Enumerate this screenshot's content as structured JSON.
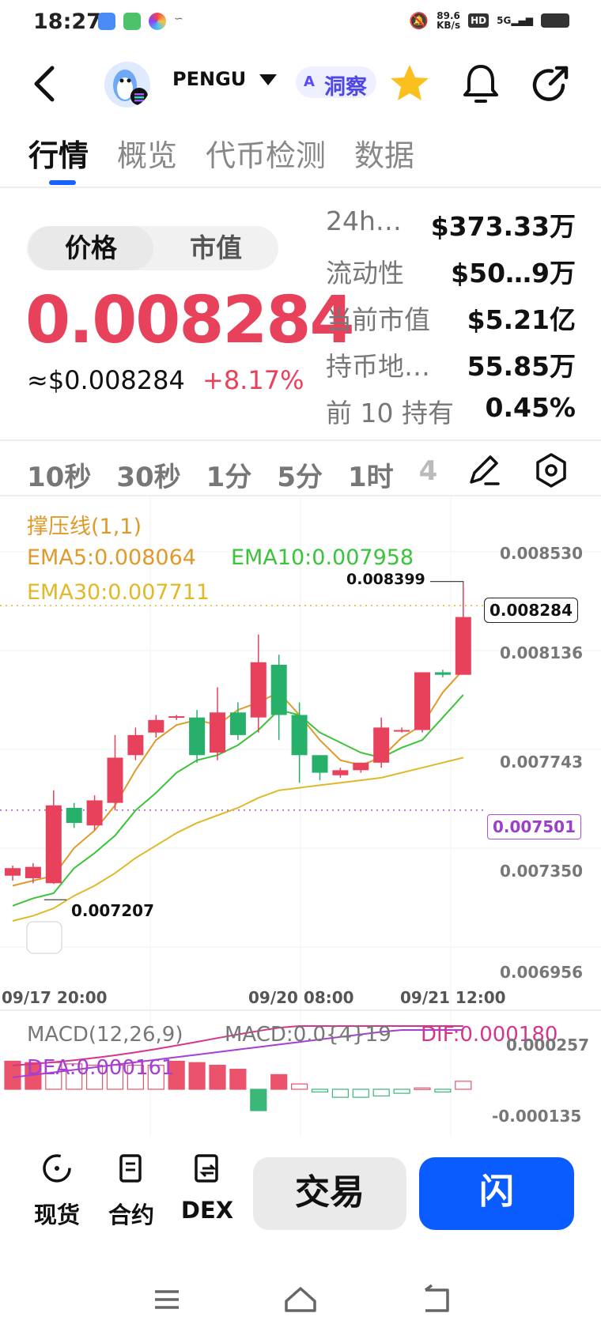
{
  "status_bar": {
    "time": "18:27",
    "net_speed": "89.6",
    "net_unit": "KB/s",
    "hd": "HD",
    "signal": "5G"
  },
  "header": {
    "token": "PENGU",
    "ai_prefix": "A",
    "ai_label": "洞察"
  },
  "tabs": [
    {
      "label": "行情",
      "active": true
    },
    {
      "label": "概览",
      "active": false
    },
    {
      "label": "代币检测",
      "active": false
    },
    {
      "label": "数据",
      "active": false
    }
  ],
  "price_toggle": {
    "price": "价格",
    "market_cap": "市值"
  },
  "price": {
    "main": "0.008284",
    "usd": "≈$0.008284",
    "change": "+8.17%"
  },
  "stats": [
    {
      "label": "24h…",
      "value": "$373.33万"
    },
    {
      "label": "流动性",
      "value": "$50…9万"
    },
    {
      "label": "当前市值",
      "value": "$5.21亿"
    },
    {
      "label": "持币地…",
      "value": "55.85万"
    },
    {
      "label": "前 10 持有",
      "value": "0.45%"
    }
  ],
  "timeframes": [
    "10秒",
    "30秒",
    "1分",
    "5分",
    "1时",
    "4"
  ],
  "legend": {
    "support": "撑压线(1,1)",
    "ema5": "EMA5:0.008064",
    "ema10": "EMA10:0.007958",
    "ema30": "EMA30:0.007711"
  },
  "axis": {
    "y_labels": [
      "0.008530",
      "0.008136",
      "0.007743",
      "0.007350",
      "0.006956"
    ],
    "current_tag": "0.008284",
    "support_tag": "0.007501",
    "high_label": "0.008399",
    "low_label": "0.007207",
    "x_labels": [
      "09/17 20:00",
      "09/20 08:00",
      "09/21 12:00"
    ]
  },
  "macd": {
    "title": "MACD(12,26,9)",
    "macd": "MACD:0.0{4}19",
    "dif": "DIF:0.000180",
    "dea": "DEA:0.000161",
    "y_top": "0.000257",
    "y_bottom": "-0.000135"
  },
  "colors": {
    "up": "#e8415b",
    "down": "#26b06a",
    "accent": "#1663ff",
    "ema5": "#e09a2a",
    "ema10": "#3ac43a",
    "ema30": "#e0b82a"
  },
  "chart_data": {
    "type": "candlestick",
    "ylim": [
      0.006956,
      0.00853
    ],
    "candles": [
      {
        "o": 0.00724,
        "c": 0.00727,
        "h": 0.00728,
        "l": 0.00722
      },
      {
        "o": 0.00723,
        "c": 0.007275,
        "h": 0.00729,
        "l": 0.00721
      },
      {
        "o": 0.00721,
        "c": 0.00752,
        "h": 0.00758,
        "l": 0.007207
      },
      {
        "o": 0.00751,
        "c": 0.00745,
        "h": 0.00753,
        "l": 0.00743
      },
      {
        "o": 0.00744,
        "c": 0.00754,
        "h": 0.00756,
        "l": 0.00742
      },
      {
        "o": 0.00753,
        "c": 0.00771,
        "h": 0.0078,
        "l": 0.0075
      },
      {
        "o": 0.00772,
        "c": 0.0078,
        "h": 0.00783,
        "l": 0.0077
      },
      {
        "o": 0.00781,
        "c": 0.00786,
        "h": 0.00788,
        "l": 0.00779
      },
      {
        "o": 0.00787,
        "c": 0.007875,
        "h": 0.00788,
        "l": 0.00786
      },
      {
        "o": 0.00787,
        "c": 0.00772,
        "h": 0.0079,
        "l": 0.00769
      },
      {
        "o": 0.00773,
        "c": 0.00789,
        "h": 0.00799,
        "l": 0.0077
      },
      {
        "o": 0.00789,
        "c": 0.0078,
        "h": 0.00793,
        "l": 0.00778
      },
      {
        "o": 0.00787,
        "c": 0.00809,
        "h": 0.0082,
        "l": 0.00781
      },
      {
        "o": 0.00808,
        "c": 0.00788,
        "h": 0.00812,
        "l": 0.00778
      },
      {
        "o": 0.00788,
        "c": 0.00772,
        "h": 0.00793,
        "l": 0.00761
      },
      {
        "o": 0.00772,
        "c": 0.00765,
        "h": 0.00772,
        "l": 0.00762
      },
      {
        "o": 0.00764,
        "c": 0.00766,
        "h": 0.00767,
        "l": 0.00763
      },
      {
        "o": 0.00766,
        "c": 0.00769,
        "h": 0.00769,
        "l": 0.00765
      },
      {
        "o": 0.00769,
        "c": 0.00783,
        "h": 0.00787,
        "l": 0.00767
      },
      {
        "o": 0.00782,
        "c": 0.00782,
        "h": 0.00783,
        "l": 0.00781
      },
      {
        "o": 0.00782,
        "c": 0.00805,
        "h": 0.00805,
        "l": 0.00781
      },
      {
        "o": 0.00805,
        "c": 0.00804,
        "h": 0.00806,
        "l": 0.00803
      },
      {
        "o": 0.00804,
        "c": 0.00827,
        "h": 0.008399,
        "l": 0.00804
      }
    ],
    "ema5": [
      0.0072,
      0.00722,
      0.00724,
      0.00735,
      0.00742,
      0.00752,
      0.00766,
      0.00778,
      0.00784,
      0.00786,
      0.00784,
      0.0079,
      0.00793,
      0.00797,
      0.00788,
      0.00778,
      0.0077,
      0.00768,
      0.00771,
      0.00779,
      0.00784,
      0.00797,
      0.00806
    ],
    "ema10": [
      0.00712,
      0.00715,
      0.00717,
      0.00727,
      0.00733,
      0.0074,
      0.0075,
      0.00757,
      0.00765,
      0.0077,
      0.00772,
      0.00776,
      0.00782,
      0.0079,
      0.00788,
      0.00781,
      0.00777,
      0.00773,
      0.00771,
      0.00775,
      0.00778,
      0.00787,
      0.00796
    ],
    "ema30": [
      0.00706,
      0.00708,
      0.00711,
      0.00716,
      0.0072,
      0.00725,
      0.00731,
      0.00736,
      0.00741,
      0.00745,
      0.00748,
      0.00751,
      0.00755,
      0.00758,
      0.00759,
      0.0076,
      0.00761,
      0.00762,
      0.00763,
      0.00765,
      0.00767,
      0.00769,
      0.00771
    ],
    "support_level": 0.007501,
    "current_level": 0.008284,
    "macd_hist": [
      4.2e-05,
      4e-05,
      4e-05,
      3.8e-05,
      3.6e-05,
      3.6e-05,
      3.6e-05,
      3.6e-05,
      4.2e-05,
      4e-05,
      3.6e-05,
      3e-05,
      -3.2e-05,
      2.2e-05,
      8e-06,
      -4e-06,
      -1.2e-05,
      -1.2e-05,
      -1e-05,
      -6e-06,
      2e-06,
      -4e-06,
      1.2e-05
    ]
  },
  "bottom_nav": [
    {
      "label": "现货",
      "icon": "spot-icon"
    },
    {
      "label": "合约",
      "icon": "contract-icon"
    },
    {
      "label": "DEX",
      "icon": "dex-icon"
    }
  ],
  "actions": {
    "trade": "交易",
    "flash": "闪"
  }
}
